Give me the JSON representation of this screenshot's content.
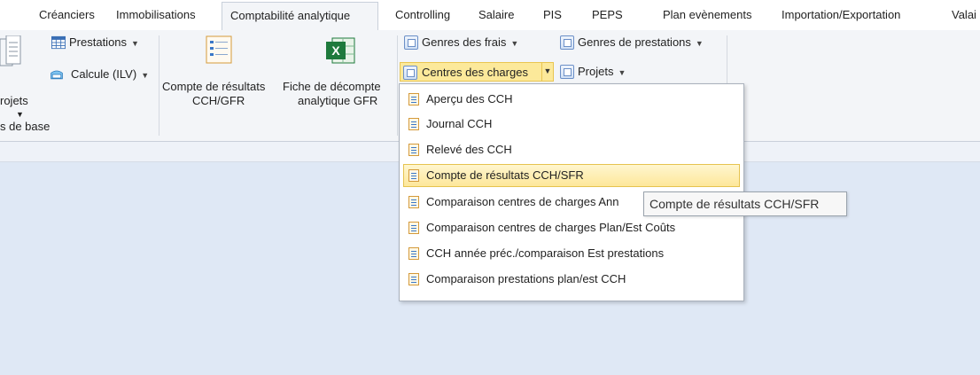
{
  "tabs": [
    {
      "label": "Créanciers"
    },
    {
      "label": "Immobilisations"
    },
    {
      "label": "Comptabilité analytique",
      "active": true
    },
    {
      "label": "Controlling"
    },
    {
      "label": "Salaire"
    },
    {
      "label": "PIS"
    },
    {
      "label": "PEPS"
    },
    {
      "label": "Plan evènements"
    },
    {
      "label": "Importation/Exportation"
    },
    {
      "label": "Valai"
    }
  ],
  "ribbon": {
    "prestations_label": "Prestations",
    "calcule_label": "Calcule (ILV)",
    "projets_left_label": "rojets",
    "group_base_label": "s de base",
    "compte_resultats_line1": "Compte de résultats",
    "compte_resultats_line2": "CCH/GFR",
    "fiche_line1": "Fiche de décompte",
    "fiche_line2": "analytique GFR",
    "genres_frais_label": "Genres des frais",
    "genres_prestations_label": "Genres de prestations",
    "centres_charges_label": "Centres des charges",
    "projets_label": "Projets"
  },
  "menu": {
    "items": [
      {
        "label": "Aperçu des CCH"
      },
      {
        "label": "Journal CCH"
      },
      {
        "label": "Relevé des CCH"
      },
      {
        "label": "Compte de résultats CCH/SFR",
        "hover": true
      },
      {
        "label": "Comparaison centres de charges Ann"
      },
      {
        "label": "Comparaison centres de charges Plan/Est Coûts"
      },
      {
        "label": "CCH année préc./comparaison Est prestations"
      },
      {
        "label": "Comparaison prestations plan/est CCH"
      }
    ]
  },
  "tooltip": "Compte de résultats CCH/SFR",
  "colors": {
    "highlight": "#fce99a",
    "background": "#dfe8f5",
    "excel_green": "#1e7a3c"
  }
}
